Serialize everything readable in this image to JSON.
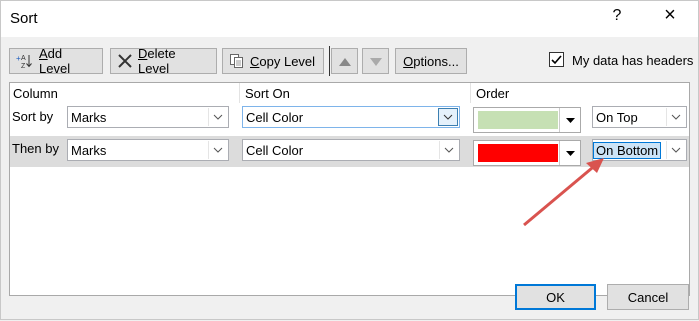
{
  "window": {
    "title": "Sort",
    "help_label": "?",
    "close_label": "×"
  },
  "toolbar": {
    "add_level": "Add Level",
    "delete_level": "Delete Level",
    "copy_level": "Copy Level",
    "options": "Options...",
    "headers_checkbox_label": "My data has headers",
    "headers_checked": true
  },
  "columns": {
    "column": "Column",
    "sort_on": "Sort On",
    "order": "Order"
  },
  "rows": [
    {
      "label": "Sort by",
      "column": "Marks",
      "sort_on": "Cell Color",
      "color": "#c6e0b4",
      "position": "On Top"
    },
    {
      "label": "Then by",
      "column": "Marks",
      "sort_on": "Cell Color",
      "color": "#ff0000",
      "position": "On Bottom"
    }
  ],
  "footer": {
    "ok_label": "OK",
    "cancel_label": "Cancel"
  },
  "annotation_color": "#d9534f"
}
